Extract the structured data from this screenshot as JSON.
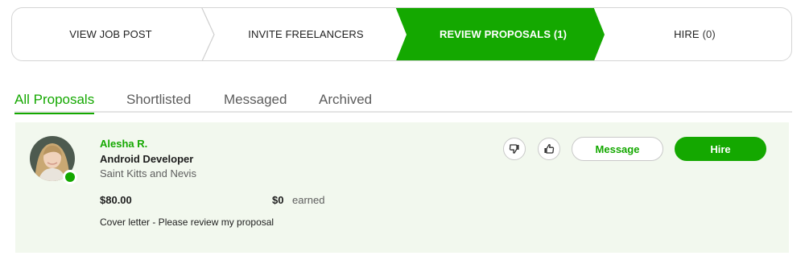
{
  "stepper": {
    "steps": [
      {
        "label": "View Job Post",
        "active": false
      },
      {
        "label": "Invite Freelancers",
        "active": false
      },
      {
        "label": "Review Proposals (1)",
        "active": true
      },
      {
        "label": "Hire",
        "count": "(0)",
        "active": false
      }
    ]
  },
  "tabs": [
    {
      "label": "All Proposals",
      "active": true
    },
    {
      "label": "Shortlisted",
      "active": false
    },
    {
      "label": "Messaged",
      "active": false
    },
    {
      "label": "Archived",
      "active": false
    }
  ],
  "proposal": {
    "name": "Alesha R.",
    "title": "Android Developer",
    "location": "Saint Kitts and Nevis",
    "rate": "$80.00",
    "earned_amount": "$0",
    "earned_label": "earned",
    "cover_letter": "Cover letter - Please review my proposal",
    "online": true,
    "actions": {
      "dislike_icon": "thumbs-down-icon",
      "like_icon": "thumbs-up-icon",
      "message_label": "Message",
      "hire_label": "Hire"
    }
  },
  "colors": {
    "brand_green": "#14a800",
    "card_bg": "#f2f8ee",
    "border": "#d5d5d5"
  }
}
